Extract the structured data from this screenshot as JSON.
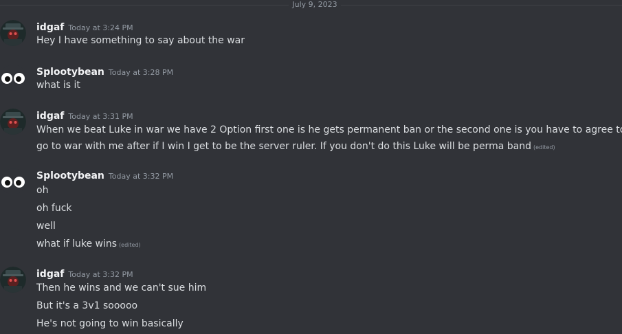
{
  "date_divider": "July 9, 2023",
  "edited_label": "(edited)",
  "messages": [
    {
      "username": "idgaf",
      "timestamp": "Today at 3:24 PM",
      "avatar": "masked-figure-avatar",
      "lines": [
        "Hey I have something to say about the war"
      ]
    },
    {
      "username": "Splootybean",
      "timestamp": "Today at 3:28 PM",
      "avatar": "googly-eyes-avatar",
      "lines": [
        "what is it"
      ]
    },
    {
      "username": "idgaf",
      "timestamp": "Today at 3:31 PM",
      "avatar": "masked-figure-avatar",
      "lines": [
        "When we beat Luke in war we have 2 Option first one is he gets  permanent ban or the second one is you have to agree to",
        "go to war with me after if I win I get to be the server ruler. If you don't do this Luke will be perma band"
      ]
    },
    {
      "username": "Splootybean",
      "timestamp": "Today at 3:32 PM",
      "avatar": "googly-eyes-avatar",
      "lines": [
        "oh",
        "oh fuck",
        "well",
        "what if luke wins"
      ]
    },
    {
      "username": "idgaf",
      "timestamp": "Today at 3:32 PM",
      "avatar": "masked-figure-avatar",
      "lines": [
        "Then he wins and we can't sue him",
        "But it's a 3v1 sooooo",
        "He's not going to win basically"
      ]
    }
  ],
  "colors": {
    "background": "#313338",
    "text": "#dbdee1",
    "username": "#f2f3f5",
    "muted": "#949ba4"
  }
}
